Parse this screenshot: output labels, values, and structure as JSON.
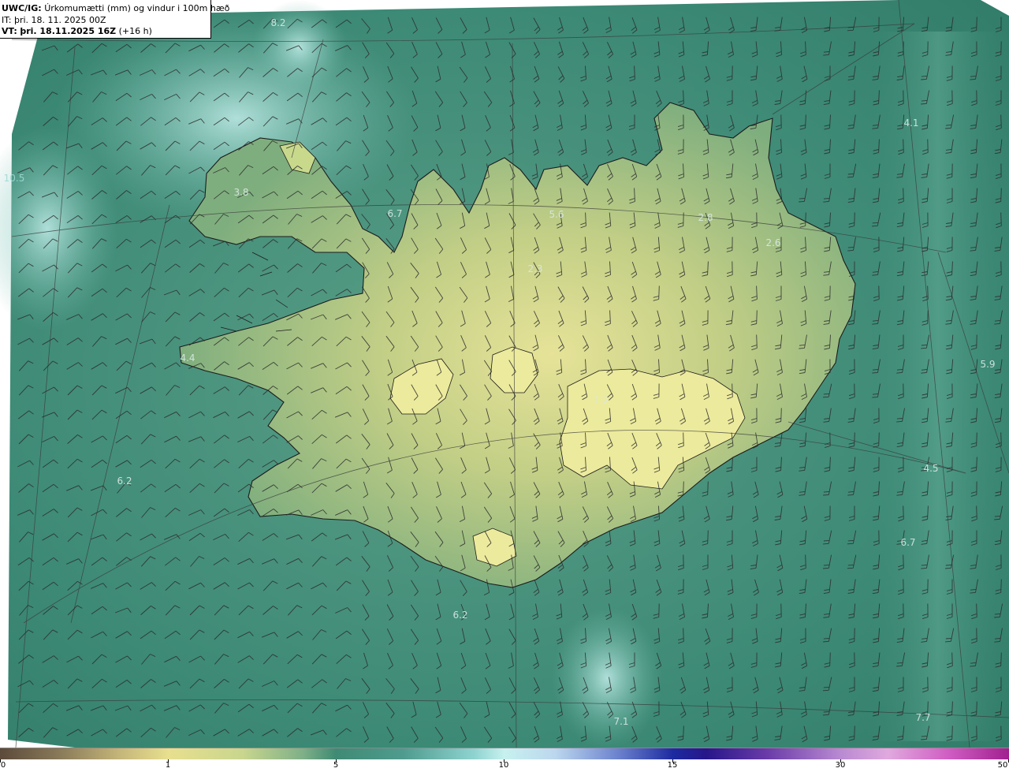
{
  "header": {
    "product": "UWC/IG:",
    "title": "Úrkomumætti (mm) og vindur i 100m hæð",
    "init_prefix": "IT:",
    "init_time": "þri. 18. 11. 2025 00Z",
    "valid_prefix": "VT:",
    "valid_time": "þri. 18.11.2025 16Z",
    "lead_time": "(+16 h)"
  },
  "value_labels": [
    {
      "text": "8.2"
    },
    {
      "text": "10.5"
    },
    {
      "text": "3.8"
    },
    {
      "text": "6.7"
    },
    {
      "text": "5.6"
    },
    {
      "text": "2.8"
    },
    {
      "text": "2.6"
    },
    {
      "text": "4.1"
    },
    {
      "text": "2.3"
    },
    {
      "text": "4.4"
    },
    {
      "text": "6.2"
    },
    {
      "text": "5.9"
    },
    {
      "text": "1.2"
    },
    {
      "text": "4.5"
    },
    {
      "text": "6.7"
    },
    {
      "text": "6.2"
    },
    {
      "text": "7.1"
    },
    {
      "text": "7.7"
    }
  ],
  "colorbar": {
    "ticks": [
      "0",
      "1",
      "5",
      "10",
      "15",
      "30",
      "50"
    ],
    "colors": {
      "dry": "#5c4a3a",
      "low": "#e8df8f",
      "mid": "#3f8a74",
      "high": "#c7f1ef",
      "very_high": "#1d2aa0",
      "extreme": "#a0208f"
    }
  },
  "colors": {
    "sea_base": "#3d8a76",
    "land_coast": "#8fb57e",
    "land_interior": "#d9dc8a",
    "coastline": "#1c1c1c",
    "grid": "#3a3a3a",
    "barb": "#2b2b2b"
  }
}
